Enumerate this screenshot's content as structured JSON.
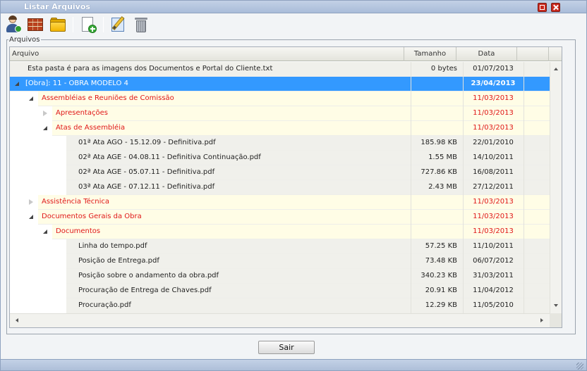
{
  "window": {
    "title": "Listar Arquivos"
  },
  "toolbar": {
    "icons": [
      "user-check-icon",
      "brick-wall-icon",
      "folder-icon",
      "new-file-icon",
      "edit-icon",
      "trash-icon"
    ]
  },
  "fieldset": {
    "legend": "Arquivos"
  },
  "grid": {
    "columns": {
      "name": "Arquivo",
      "size": "Tamanho",
      "date": "Data"
    },
    "rows": [
      {
        "type": "file",
        "level": 0,
        "name": "Esta pasta é para as imagens dos Documentos e Portal do Cliente.txt",
        "size": "0 bytes",
        "date": "01/07/2013"
      },
      {
        "type": "selected",
        "level": 0,
        "toggle": "open",
        "name": "[Obra]: 11 - OBRA MODELO 4",
        "size": "",
        "date": "23/04/2013"
      },
      {
        "type": "folder",
        "level": 1,
        "toggle": "open",
        "name": "Assembléias e Reuniões de Comissão",
        "size": "",
        "date": "11/03/2013"
      },
      {
        "type": "folder",
        "level": 2,
        "toggle": "closed",
        "name": "Apresentações",
        "size": "",
        "date": "11/03/2013"
      },
      {
        "type": "folder",
        "level": 2,
        "toggle": "open",
        "name": "Atas de Assembléia",
        "size": "",
        "date": "11/03/2013"
      },
      {
        "type": "file",
        "level": 3,
        "name": "01ª Ata AGO - 15.12.09 - Definitiva.pdf",
        "size": "185.98 KB",
        "date": "22/01/2010"
      },
      {
        "type": "file",
        "level": 3,
        "name": "02ª Ata AGE - 04.08.11 - Definitiva Continuação.pdf",
        "size": "1.55 MB",
        "date": "14/10/2011"
      },
      {
        "type": "file",
        "level": 3,
        "name": "02ª Ata AGE - 05.07.11 - Definitiva.pdf",
        "size": "727.86 KB",
        "date": "16/08/2011"
      },
      {
        "type": "file",
        "level": 3,
        "name": "03ª Ata AGE - 07.12.11 - Definitiva.pdf",
        "size": "2.43 MB",
        "date": "27/12/2011"
      },
      {
        "type": "folder",
        "level": 1,
        "toggle": "closed",
        "name": "Assistência Técnica",
        "size": "",
        "date": "11/03/2013"
      },
      {
        "type": "folder",
        "level": 1,
        "toggle": "open",
        "name": "Documentos Gerais da Obra",
        "size": "",
        "date": "11/03/2013"
      },
      {
        "type": "folder",
        "level": 2,
        "toggle": "open",
        "name": "Documentos",
        "size": "",
        "date": "11/03/2013"
      },
      {
        "type": "file",
        "level": 3,
        "name": "Linha do tempo.pdf",
        "size": "57.25 KB",
        "date": "11/10/2011"
      },
      {
        "type": "file",
        "level": 3,
        "name": "Posição de Entrega.pdf",
        "size": "73.48 KB",
        "date": "06/07/2012"
      },
      {
        "type": "file",
        "level": 3,
        "name": "Posição sobre o andamento da obra.pdf",
        "size": "340.23 KB",
        "date": "31/03/2011"
      },
      {
        "type": "file",
        "level": 3,
        "name": "Procuração de Entrega de Chaves.pdf",
        "size": "20.91 KB",
        "date": "11/04/2012"
      },
      {
        "type": "file",
        "level": 3,
        "name": "Procuração.pdf",
        "size": "12.29 KB",
        "date": "11/05/2010"
      }
    ]
  },
  "footer": {
    "exit_label": "Sair"
  }
}
